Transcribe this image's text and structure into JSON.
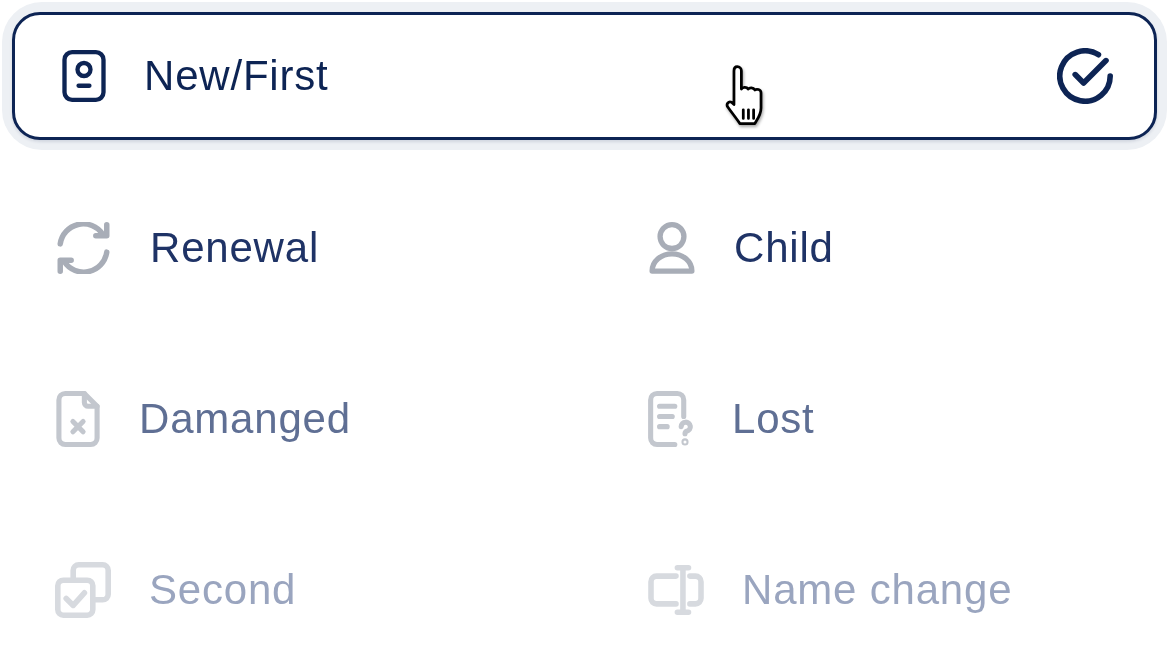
{
  "options": [
    {
      "label": "New/First",
      "selected": true
    },
    {
      "label": "Renewal",
      "selected": false
    },
    {
      "label": "Child",
      "selected": false
    },
    {
      "label": "Damanged",
      "selected": false
    },
    {
      "label": "Lost",
      "selected": false
    },
    {
      "label": "Second",
      "selected": false
    },
    {
      "label": "Name change",
      "selected": false
    }
  ]
}
